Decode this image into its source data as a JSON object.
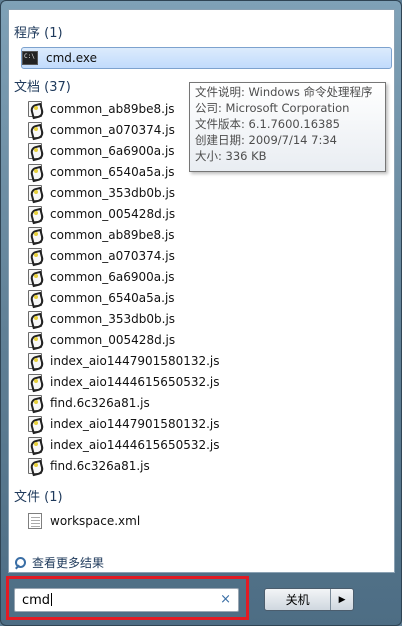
{
  "sections": {
    "programs": "程序 (1)",
    "documents": "文档 (37)",
    "files": "文件 (1)"
  },
  "programs": [
    {
      "label": "cmd.exe",
      "icon": "cmd-icon"
    }
  ],
  "tooltip": [
    "文件说明: Windows 命令处理程序",
    "公司: Microsoft Corporation",
    "文件版本: 6.1.7600.16385",
    "创建日期: 2009/7/14 7:34",
    "大小: 336 KB"
  ],
  "documents": [
    "common_ab89be8.js",
    "common_a070374.js",
    "common_6a6900a.js",
    "common_6540a5a.js",
    "common_353db0b.js",
    "common_005428d.js",
    "common_ab89be8.js",
    "common_a070374.js",
    "common_6a6900a.js",
    "common_6540a5a.js",
    "common_353db0b.js",
    "common_005428d.js",
    "index_aio1447901580132.js",
    "index_aio1444615650532.js",
    "find.6c326a81.js",
    "index_aio1447901580132.js",
    "index_aio1444615650532.js",
    "find.6c326a81.js"
  ],
  "files": [
    "workspace.xml"
  ],
  "more_results": "查看更多结果",
  "search": {
    "value": "cmd",
    "clear": "×"
  },
  "shutdown": {
    "label": "关机",
    "arrow": "▶"
  },
  "colors": {
    "section_title": "#1e395b",
    "highlight_box": "#e11b24"
  }
}
